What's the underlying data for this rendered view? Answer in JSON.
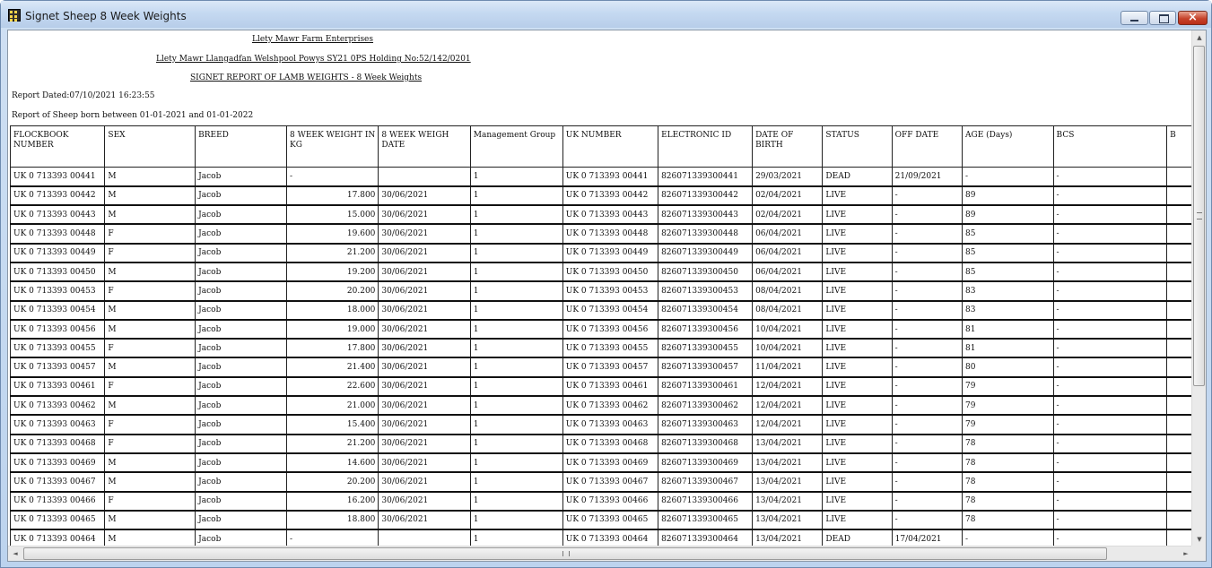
{
  "window": {
    "title": "Signet Sheep 8 Week Weights",
    "controls": {
      "minimize": "minimize",
      "maximize": "maximize",
      "close": "×"
    }
  },
  "report": {
    "farm_name": "Llety Mawr Farm Enterprises",
    "address": "Llety Mawr Llangadfan Welshpool Powys SY21 0PS Holding No:52/142/0201",
    "report_title": "SIGNET REPORT OF LAMB WEIGHTS - 8 Week Weights",
    "report_dated": "Report Dated:07/10/2021 16:23:55",
    "date_range": "Report of Sheep born between 01-01-2021 and 01-01-2022"
  },
  "table": {
    "columns": [
      "FLOCKBOOK NUMBER",
      "SEX",
      "BREED",
      "8 WEEK WEIGHT IN KG",
      "8 WEEK WEIGH DATE",
      "Management Group",
      "UK NUMBER",
      "ELECTRONIC ID",
      "DATE OF BIRTH",
      "STATUS",
      "OFF DATE",
      "AGE (Days)",
      "BCS",
      "B"
    ],
    "rows": [
      [
        "UK 0 713393 00441",
        "M",
        "Jacob",
        "-",
        "",
        "1",
        "UK 0 713393 00441",
        "826071339300441",
        "29/03/2021",
        "DEAD",
        "21/09/2021",
        "-",
        "-",
        ""
      ],
      [
        "UK 0 713393 00442",
        "M",
        "Jacob",
        "17.800",
        "30/06/2021",
        "1",
        "UK 0 713393 00442",
        "826071339300442",
        "02/04/2021",
        "LIVE",
        "-",
        "89",
        "-",
        ""
      ],
      [
        "UK 0 713393 00443",
        "M",
        "Jacob",
        "15.000",
        "30/06/2021",
        "1",
        "UK 0 713393 00443",
        "826071339300443",
        "02/04/2021",
        "LIVE",
        "-",
        "89",
        "-",
        ""
      ],
      [
        "UK 0 713393 00448",
        "F",
        "Jacob",
        "19.600",
        "30/06/2021",
        "1",
        "UK 0 713393 00448",
        "826071339300448",
        "06/04/2021",
        "LIVE",
        "-",
        "85",
        "-",
        ""
      ],
      [
        "UK 0 713393 00449",
        "F",
        "Jacob",
        "21.200",
        "30/06/2021",
        "1",
        "UK 0 713393 00449",
        "826071339300449",
        "06/04/2021",
        "LIVE",
        "-",
        "85",
        "-",
        ""
      ],
      [
        "UK 0 713393 00450",
        "M",
        "Jacob",
        "19.200",
        "30/06/2021",
        "1",
        "UK 0 713393 00450",
        "826071339300450",
        "06/04/2021",
        "LIVE",
        "-",
        "85",
        "-",
        ""
      ],
      [
        "UK 0 713393 00453",
        "F",
        "Jacob",
        "20.200",
        "30/06/2021",
        "1",
        "UK 0 713393 00453",
        "826071339300453",
        "08/04/2021",
        "LIVE",
        "-",
        "83",
        "-",
        ""
      ],
      [
        "UK 0 713393 00454",
        "M",
        "Jacob",
        "18.000",
        "30/06/2021",
        "1",
        "UK 0 713393 00454",
        "826071339300454",
        "08/04/2021",
        "LIVE",
        "-",
        "83",
        "-",
        ""
      ],
      [
        "UK 0 713393 00456",
        "M",
        "Jacob",
        "19.000",
        "30/06/2021",
        "1",
        "UK 0 713393 00456",
        "826071339300456",
        "10/04/2021",
        "LIVE",
        "-",
        "81",
        "-",
        ""
      ],
      [
        "UK 0 713393 00455",
        "F",
        "Jacob",
        "17.800",
        "30/06/2021",
        "1",
        "UK 0 713393 00455",
        "826071339300455",
        "10/04/2021",
        "LIVE",
        "-",
        "81",
        "-",
        ""
      ],
      [
        "UK 0 713393 00457",
        "M",
        "Jacob",
        "21.400",
        "30/06/2021",
        "1",
        "UK 0 713393 00457",
        "826071339300457",
        "11/04/2021",
        "LIVE",
        "-",
        "80",
        "-",
        ""
      ],
      [
        "UK 0 713393 00461",
        "F",
        "Jacob",
        "22.600",
        "30/06/2021",
        "1",
        "UK 0 713393 00461",
        "826071339300461",
        "12/04/2021",
        "LIVE",
        "-",
        "79",
        "-",
        ""
      ],
      [
        "UK 0 713393 00462",
        "M",
        "Jacob",
        "21.000",
        "30/06/2021",
        "1",
        "UK 0 713393 00462",
        "826071339300462",
        "12/04/2021",
        "LIVE",
        "-",
        "79",
        "-",
        ""
      ],
      [
        "UK 0 713393 00463",
        "F",
        "Jacob",
        "15.400",
        "30/06/2021",
        "1",
        "UK 0 713393 00463",
        "826071339300463",
        "12/04/2021",
        "LIVE",
        "-",
        "79",
        "-",
        ""
      ],
      [
        "UK 0 713393 00468",
        "F",
        "Jacob",
        "21.200",
        "30/06/2021",
        "1",
        "UK 0 713393 00468",
        "826071339300468",
        "13/04/2021",
        "LIVE",
        "-",
        "78",
        "-",
        ""
      ],
      [
        "UK 0 713393 00469",
        "M",
        "Jacob",
        "14.600",
        "30/06/2021",
        "1",
        "UK 0 713393 00469",
        "826071339300469",
        "13/04/2021",
        "LIVE",
        "-",
        "78",
        "-",
        ""
      ],
      [
        "UK 0 713393 00467",
        "M",
        "Jacob",
        "20.200",
        "30/06/2021",
        "1",
        "UK 0 713393 00467",
        "826071339300467",
        "13/04/2021",
        "LIVE",
        "-",
        "78",
        "-",
        ""
      ],
      [
        "UK 0 713393 00466",
        "F",
        "Jacob",
        "16.200",
        "30/06/2021",
        "1",
        "UK 0 713393 00466",
        "826071339300466",
        "13/04/2021",
        "LIVE",
        "-",
        "78",
        "-",
        ""
      ],
      [
        "UK 0 713393 00465",
        "M",
        "Jacob",
        "18.800",
        "30/06/2021",
        "1",
        "UK 0 713393 00465",
        "826071339300465",
        "13/04/2021",
        "LIVE",
        "-",
        "78",
        "-",
        ""
      ],
      [
        "UK 0 713393 00464",
        "M",
        "Jacob",
        "-",
        "",
        "1",
        "UK 0 713393 00464",
        "826071339300464",
        "13/04/2021",
        "DEAD",
        "17/04/2021",
        "-",
        "-",
        ""
      ]
    ]
  },
  "scrollbars": {
    "vertical": {
      "up_arrow": "▲",
      "down_arrow": "▼"
    },
    "horizontal": {
      "left_arrow": "◄",
      "right_arrow": "►"
    }
  }
}
